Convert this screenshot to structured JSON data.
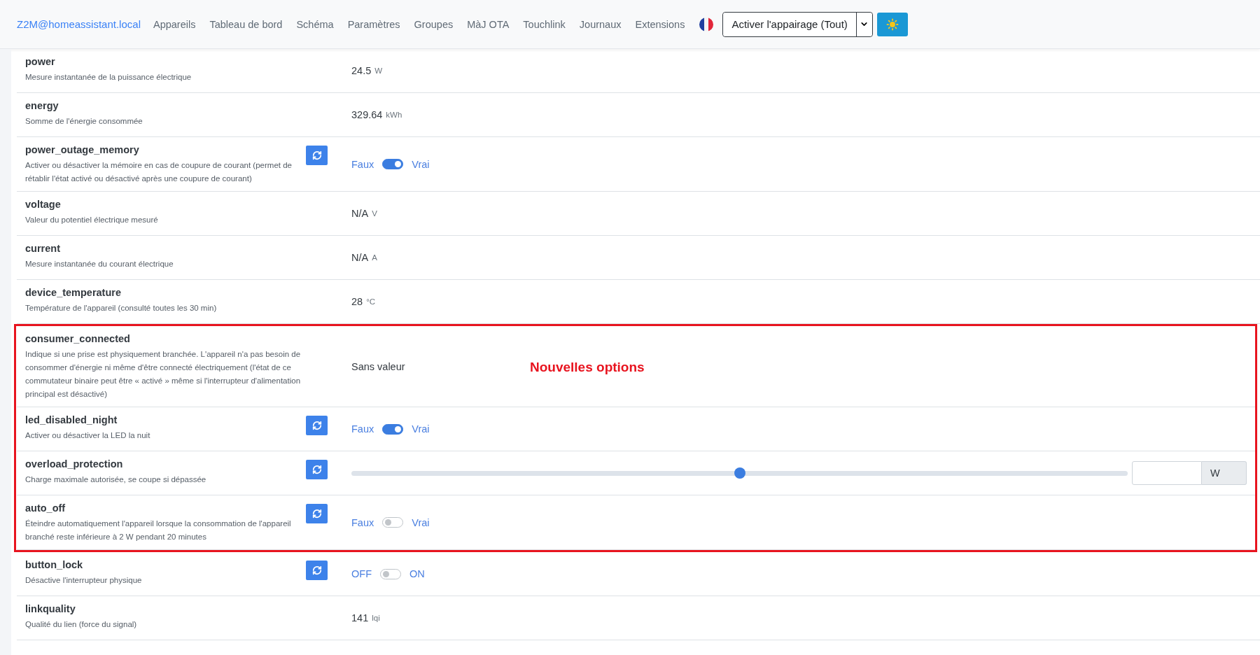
{
  "navbar": {
    "brand": "Z2M@homeassistant.local",
    "links": [
      "Appareils",
      "Tableau de bord",
      "Schéma",
      "Paramètres",
      "Groupes",
      "MàJ OTA",
      "Touchlink",
      "Journaux",
      "Extensions"
    ],
    "pairing_button": "Activer l'appairage (Tout)"
  },
  "rows": [
    {
      "kind": "value",
      "name": "power",
      "description": "Mesure instantanée de la puissance électrique",
      "value": "24.5",
      "unit": "W",
      "refresh": false
    },
    {
      "kind": "value",
      "name": "energy",
      "description": "Somme de l'énergie consommée",
      "value": "329.64",
      "unit": "kWh",
      "refresh": false
    },
    {
      "kind": "toggle",
      "name": "power_outage_memory",
      "description": "Activer ou désactiver la mémoire en cas de coupure de courant (permet de rétablir l'état activé ou désactivé après une coupure de courant)",
      "off_label": "Faux",
      "on_label": "Vrai",
      "on": true,
      "refresh": true
    },
    {
      "kind": "value",
      "name": "voltage",
      "description": "Valeur du potentiel électrique mesuré",
      "value": "N/A",
      "unit": "V",
      "refresh": false
    },
    {
      "kind": "value",
      "name": "current",
      "description": "Mesure instantanée du courant électrique",
      "value": "N/A",
      "unit": "A",
      "refresh": false
    },
    {
      "kind": "value",
      "name": "device_temperature",
      "description": "Température de l'appareil (consulté toutes les 30 min)",
      "value": "28",
      "unit": "°C",
      "refresh": false
    }
  ],
  "highlight": {
    "label": "Nouvelles options",
    "rows": [
      {
        "kind": "text",
        "name": "consumer_connected",
        "description": "Indique si une prise est physiquement branchée. L'appareil n'a pas besoin de consommer d'énergie ni même d'être connecté électriquement (l'état de ce commutateur binaire peut être « activé » même si l'interrupteur d'alimentation principal est désactivé)",
        "value": "Sans valeur",
        "refresh": false
      },
      {
        "kind": "toggle",
        "name": "led_disabled_night",
        "description": "Activer ou désactiver la LED la nuit",
        "off_label": "Faux",
        "on_label": "Vrai",
        "on": true,
        "refresh": true
      },
      {
        "kind": "slider",
        "name": "overload_protection",
        "description": "Charge maximale autorisée, se coupe si dépassée",
        "level": 0.5,
        "unit": "W",
        "refresh": true
      },
      {
        "kind": "toggle",
        "name": "auto_off",
        "description": "Éteindre automatiquement l'appareil lorsque la consommation de l'appareil branché reste inférieure à 2 W pendant 20 minutes",
        "off_label": "Faux",
        "on_label": "Vrai",
        "on": false,
        "refresh": true
      }
    ]
  },
  "rows_after": [
    {
      "kind": "toggle",
      "name": "button_lock",
      "description": "Désactive l'interrupteur physique",
      "off_label": "OFF",
      "on_label": "ON",
      "on": false,
      "refresh": true
    },
    {
      "kind": "value",
      "name": "linkquality",
      "description": "Qualité du lien (force du signal)",
      "value": "141",
      "unit": "lqi",
      "refresh": false
    }
  ]
}
